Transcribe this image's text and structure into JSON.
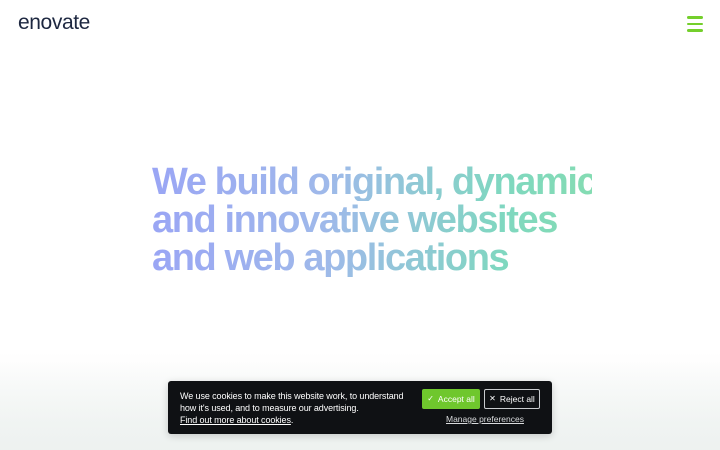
{
  "header": {
    "logo_text": "enovate",
    "menu_icon": "hamburger-menu-icon",
    "accent_color": "#74cf2c"
  },
  "hero": {
    "lines": [
      "We build original, dynamic,",
      "and innovative websites",
      "and web applications"
    ],
    "gradient_colors": [
      "#9aa5f5",
      "#9fb9ea",
      "#7fd8bf",
      "#85dcb2"
    ]
  },
  "cookie_banner": {
    "text_line1": "We use cookies to make this website work, to understand",
    "text_line2": "how it's used, and to measure our advertising.",
    "link_text": "Find out more about cookies",
    "link_suffix": ".",
    "accept_label": "Accept all",
    "accept_icon": "check-icon",
    "reject_label": "Reject all",
    "reject_icon": "close-icon",
    "manage_label": "Manage preferences",
    "background_color": "#0f1114",
    "accept_color": "#6fc72d"
  }
}
